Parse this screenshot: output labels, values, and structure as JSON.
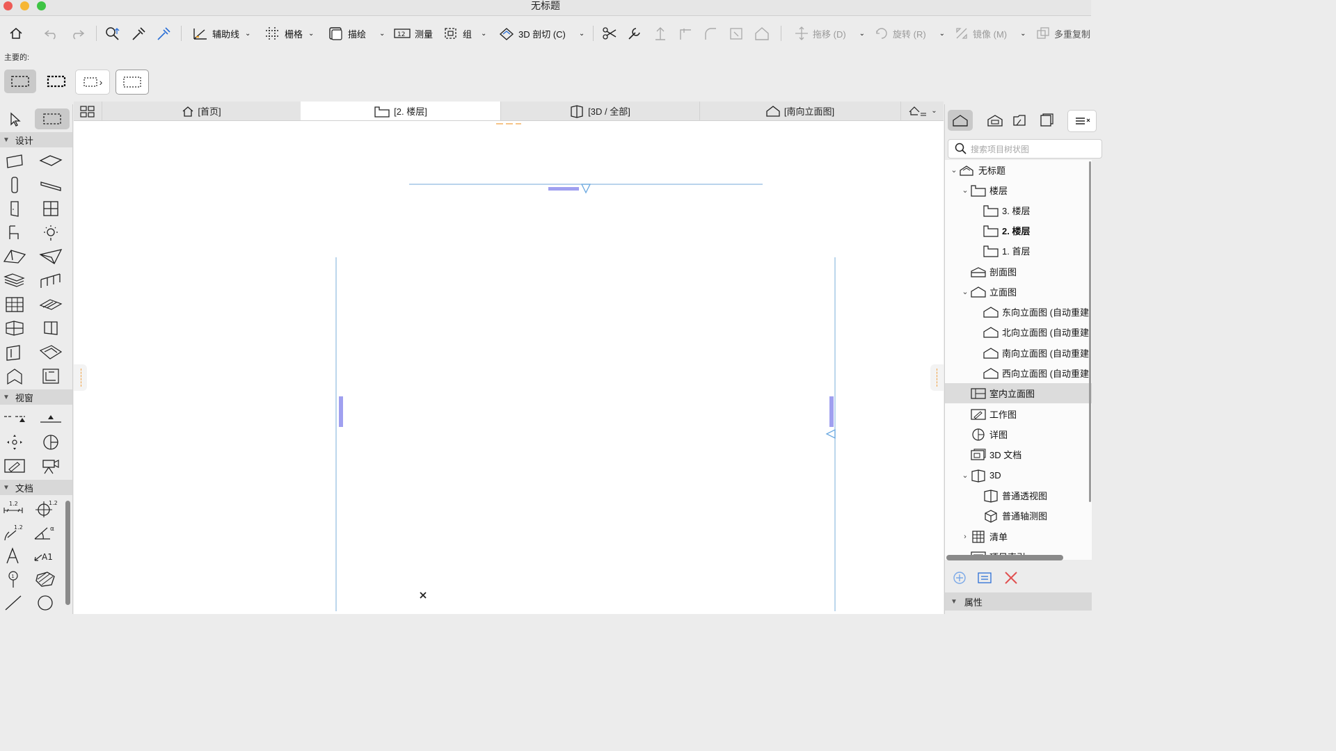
{
  "window": {
    "title": "无标题"
  },
  "toolbar": {
    "guide_line": "辅助线",
    "grid": "栅格",
    "trace": "描绘",
    "measure": "测量",
    "group": "组",
    "cut_3d": "3D 剖切 (C)",
    "drag": "拖移 (D)",
    "rotate": "旋转 (R)",
    "mirror": "镜像 (M)",
    "multiply": "多重复制"
  },
  "info_box": {
    "label": "主要的:"
  },
  "toolbox": {
    "sections": [
      "设计",
      "视窗",
      "文档"
    ]
  },
  "tabs": [
    {
      "label": "[首页]"
    },
    {
      "label": "[2. 楼层]",
      "active": true
    },
    {
      "label": "[3D / 全部]"
    },
    {
      "label": "[南向立面图]"
    }
  ],
  "navigator": {
    "search_placeholder": "搜索项目树状图",
    "nodes": [
      {
        "label": "无标题",
        "icon": "project-icon",
        "expanded": true
      },
      {
        "label": "楼层",
        "icon": "story-icon",
        "expanded": true
      },
      {
        "label": "3. 楼层",
        "icon": "story-icon"
      },
      {
        "label": "2. 楼层",
        "icon": "story-icon",
        "bold": true
      },
      {
        "label": "1. 首层",
        "icon": "story-icon"
      },
      {
        "label": "剖面图",
        "icon": "section-icon"
      },
      {
        "label": "立面图",
        "icon": "elevation-icon",
        "expanded": true
      },
      {
        "label": "东向立面图 (自动重建",
        "icon": "elevation-icon"
      },
      {
        "label": "北向立面图 (自动重建",
        "icon": "elevation-icon"
      },
      {
        "label": "南向立面图 (自动重建",
        "icon": "elevation-icon"
      },
      {
        "label": "西向立面图 (自动重建",
        "icon": "elevation-icon"
      },
      {
        "label": "室内立面图",
        "icon": "interior-elevation-icon",
        "selected": true
      },
      {
        "label": "工作图",
        "icon": "worksheet-icon"
      },
      {
        "label": "详图",
        "icon": "detail-icon"
      },
      {
        "label": "3D 文档",
        "icon": "3d-document-icon"
      },
      {
        "label": "3D",
        "icon": "3d-icon",
        "expanded": true
      },
      {
        "label": "普通透视图",
        "icon": "perspective-icon"
      },
      {
        "label": "普通轴测图",
        "icon": "axonometry-icon"
      },
      {
        "label": "清单",
        "icon": "schedule-icon",
        "collapsed": true
      },
      {
        "label": "项目索引",
        "icon": "index-icon",
        "collapsed": true
      }
    ],
    "properties_label": "属性"
  },
  "colors": {
    "accent_line": "#8fbbe0",
    "marker": "#a0a0f0",
    "selection": "#dcdcdc"
  }
}
